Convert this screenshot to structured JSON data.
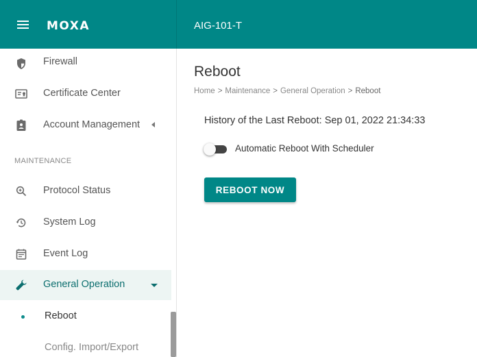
{
  "header": {
    "logo": "MOXA",
    "device": "AIG-101-T"
  },
  "sidebar": {
    "items": [
      {
        "label": "Firewall",
        "icon": "shield-icon"
      },
      {
        "label": "Certificate Center",
        "icon": "certificate-icon"
      },
      {
        "label": "Account Management",
        "icon": "account-badge-icon"
      }
    ],
    "section_label": "MAINTENANCE",
    "maintenance_items": [
      {
        "label": "Protocol Status",
        "icon": "magnify-icon"
      },
      {
        "label": "System Log",
        "icon": "history-icon"
      },
      {
        "label": "Event Log",
        "icon": "calendar-icon"
      },
      {
        "label": "General Operation",
        "icon": "wrench-icon"
      }
    ],
    "sub_items": [
      {
        "label": "Reboot"
      },
      {
        "label": "Config. Import/Export"
      }
    ]
  },
  "main": {
    "title": "Reboot",
    "breadcrumb": [
      "Home",
      "Maintenance",
      "General Operation",
      "Reboot"
    ],
    "breadcrumb_separator": ">",
    "history_text": "History of the Last Reboot: Sep 01, 2022 21:34:33",
    "toggle_label": "Automatic Reboot With Scheduler",
    "toggle_on": false,
    "button_label": "REBOOT NOW"
  },
  "colors": {
    "brand": "#008787",
    "active_bg": "#edf5f3",
    "active_text": "#0b6e6e"
  }
}
